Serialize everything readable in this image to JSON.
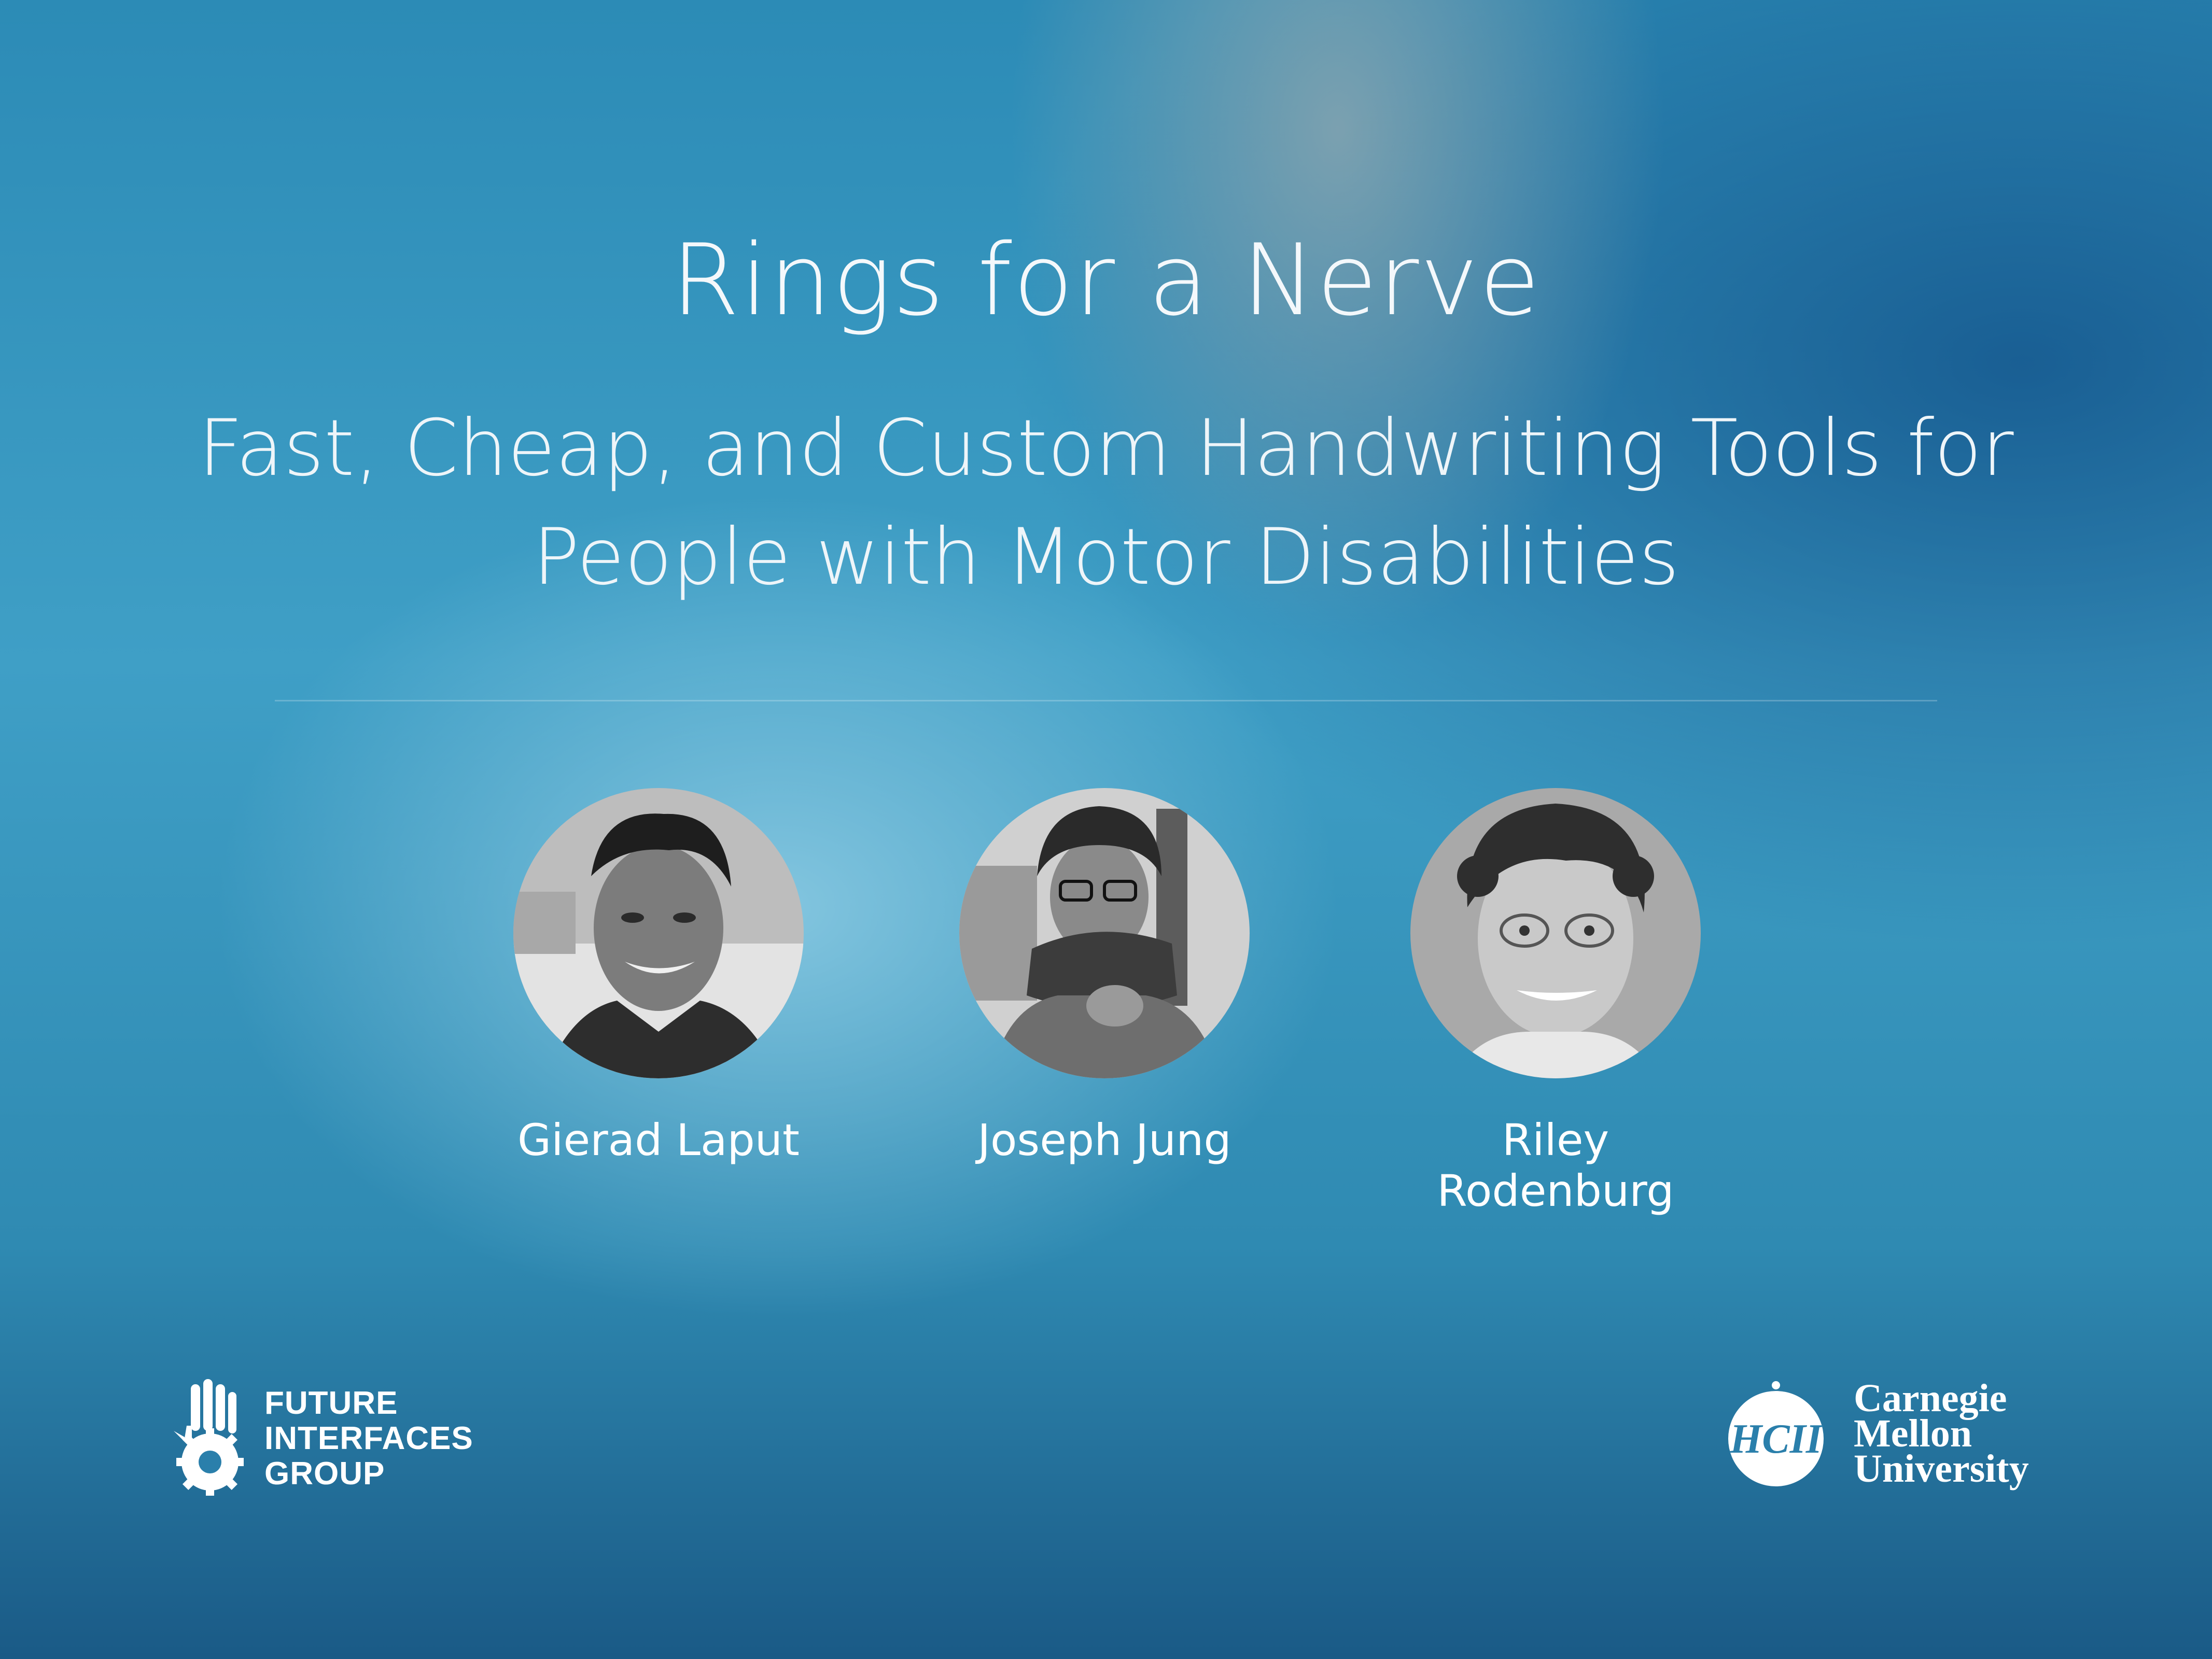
{
  "title": "Rings for a Nerve",
  "subtitle_line1": "Fast, Cheap, and Custom Handwriting Tools for",
  "subtitle_line2": "People with Motor Disabilities",
  "authors": [
    {
      "name": "Gierad Laput"
    },
    {
      "name": "Joseph Jung"
    },
    {
      "name": "Riley Rodenburg"
    }
  ],
  "logo_left": {
    "line1": "FUTURE",
    "line2": "INTERFACES",
    "line3": "GROUP",
    "icon": "hand-gear-icon"
  },
  "logo_right": {
    "badge_text": "HCII",
    "line1": "Carnegie",
    "line2": "Mellon",
    "line3": "University",
    "icon": "hcii-circle-icon"
  },
  "colors": {
    "background_top": "#2c8bb6",
    "background_center": "#87c8e1",
    "background_bottom": "#1a5a86",
    "text": "#ffffff"
  }
}
